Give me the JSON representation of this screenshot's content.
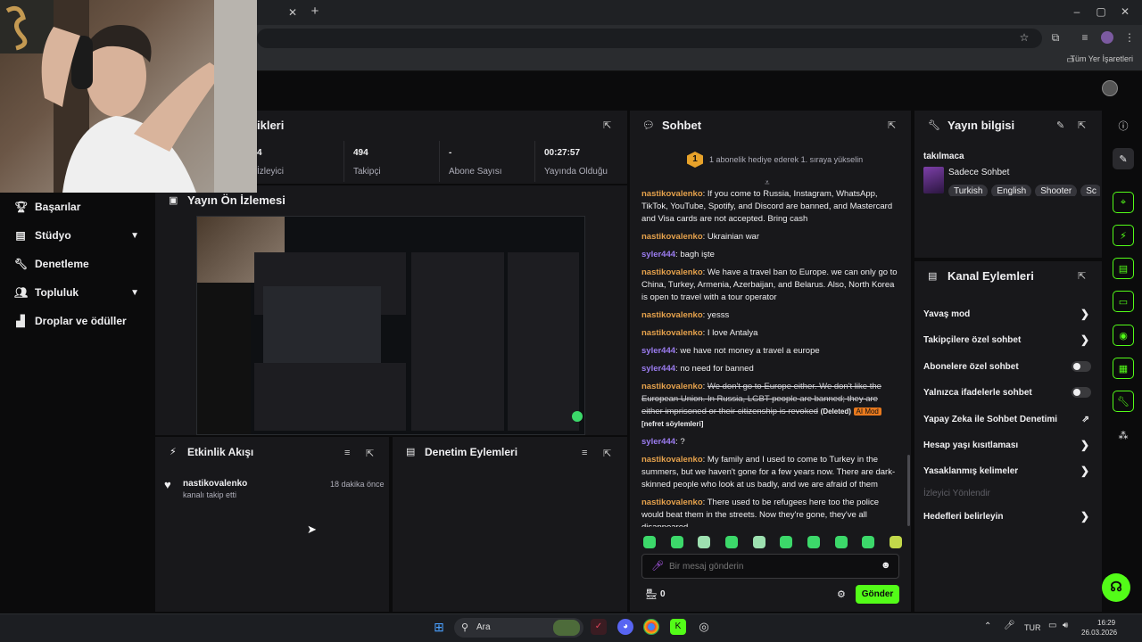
{
  "browser": {
    "close_tab": "✕",
    "new_tab": "+",
    "bookmarks_label": "Tüm Yer İşaretleri"
  },
  "sidebar": {
    "items": [
      {
        "label": "Başarılar",
        "icon": "trophy-icon"
      },
      {
        "label": "Stüdyo",
        "icon": "studio-icon",
        "expandable": true
      },
      {
        "label": "Denetleme",
        "icon": "wrench-icon"
      },
      {
        "label": "Topluluk",
        "icon": "community-icon",
        "expandable": true
      },
      {
        "label": "Droplar ve ödüller",
        "icon": "drops-icon"
      }
    ]
  },
  "stats_panel": {
    "title": "ikleri",
    "stats": [
      {
        "value": "4",
        "label": "İzleyici"
      },
      {
        "value": "494",
        "label": "Takipçi"
      },
      {
        "value": "-",
        "label": "Abone Sayısı"
      },
      {
        "value": "00:27:57",
        "label": "Yayında Olduğu"
      }
    ]
  },
  "preview_panel": {
    "title": "Yayın Ön İzlemesi"
  },
  "activity_panel": {
    "title": "Etkinlik Akışı",
    "events": [
      {
        "user": "nastikovalenko",
        "action": "kanalı takip etti",
        "time": "18 dakika önce"
      }
    ]
  },
  "mod_actions_panel": {
    "title": "Denetim Eylemleri"
  },
  "chat": {
    "title": "Sohbet",
    "gift_badge": "1",
    "gift_text": "1 abonelik hediye ederek 1. sıraya yükselin",
    "messages": [
      {
        "user": "nastikovalenko",
        "text": "If you come to Russia, Instagram, WhatsApp, TikTok, YouTube, Spotify, and Discord are banned, and Mastercard and Visa cards are not accepted. Bring cash"
      },
      {
        "user": "nastikovalenko",
        "text": "Ukrainian war"
      },
      {
        "user": "syler444",
        "text": "bagh işte"
      },
      {
        "user": "nastikovalenko",
        "text": "We have a travel ban to Europe. we can only go to China, Turkey, Armenia, Azerbaijan, and Belarus. Also, North Korea is open to travel with a tour operator"
      },
      {
        "user": "nastikovalenko",
        "text": "yesss"
      },
      {
        "user": "nastikovalenko",
        "text": "I love Antalya"
      },
      {
        "user": "syler444",
        "text": "we have not money a travel a europe"
      },
      {
        "user": "syler444",
        "text": "no need for banned"
      },
      {
        "user": "nastikovalenko",
        "text": "We don't go to Europe either. We don't like the European Union. In Russia, LGBT people are banned; they are either imprisoned or their citizenship is revoked",
        "deleted": "(Deleted)",
        "ai_badge": "AI Mod",
        "reason": "[nefret söylemleri]"
      },
      {
        "user": "syler444",
        "text": "?"
      },
      {
        "user": "nastikovalenko",
        "text": "My family and I used to come to Turkey in the summers, but we haven't gone for a few years now. There are dark-skinned people who look at us badly, and we are afraid of them"
      },
      {
        "user": "nastikovalenko",
        "text": "There used to be refugees here too the police would beat them in the streets. Now they're gone, they've all disappeared"
      }
    ],
    "input_placeholder": "Bir mesaj gönderin",
    "points": "0",
    "send_label": "Gönder"
  },
  "stream_info": {
    "title": "Yayın bilgisi",
    "stream_title": "takılmaca",
    "category": "Sadece Sohbet",
    "tags": [
      "Turkish",
      "English",
      "Shooter",
      "Sc"
    ]
  },
  "channel_actions": {
    "title": "Kanal Eylemleri",
    "items": [
      {
        "label": "Yavaş mod",
        "control": "chevron"
      },
      {
        "label": "Takipçilere özel sohbet",
        "control": "chevron"
      },
      {
        "label": "Abonelere özel sohbet",
        "control": "toggle"
      },
      {
        "label": "Yalnızca ifadelerle sohbet",
        "control": "toggle"
      },
      {
        "label": "Yapay Zeka ile Sohbet Denetimi",
        "control": "external"
      },
      {
        "label": "Hesap yaşı kısıtlaması",
        "control": "chevron"
      },
      {
        "label": "Yasaklanmış kelimeler",
        "control": "chevron"
      },
      {
        "label": "İzleyici Yönlendir",
        "control": "none",
        "disabled": true
      },
      {
        "label": "Hedefleri belirleyin",
        "control": "chevron"
      }
    ]
  },
  "taskbar": {
    "search_label": "Ara",
    "lang": "TUR",
    "time": "16:29",
    "date": "26.03.2026"
  },
  "colors": {
    "accent": "#53fc18",
    "username_a": "#e6a24c",
    "username_b": "#9b7cf0",
    "ai_badge": "#e8791e"
  }
}
